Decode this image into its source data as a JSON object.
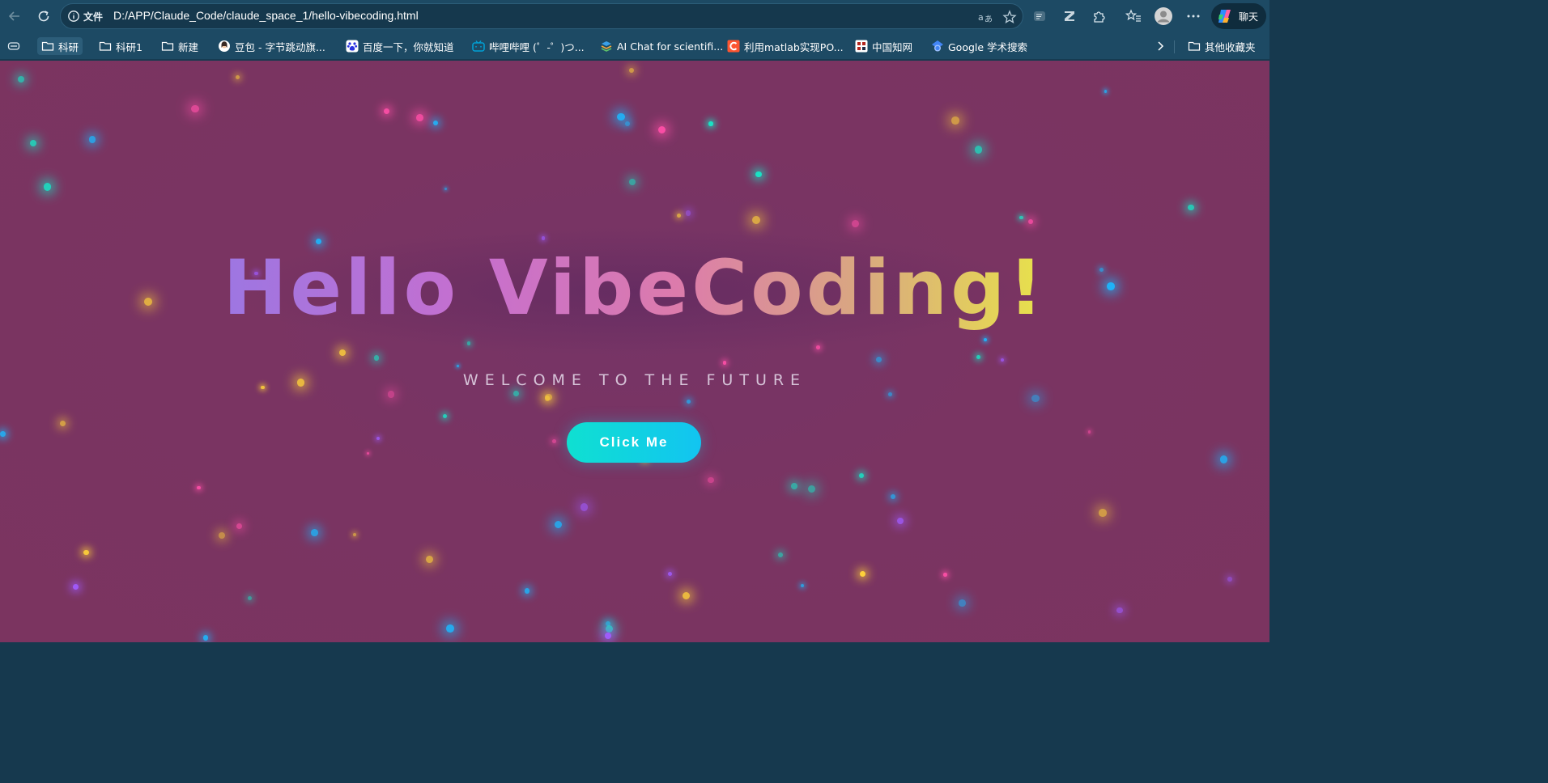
{
  "toolbar": {
    "scheme_label": "文件",
    "url": "D:/APP/Claude_Code/claude_space_1/hello-vibecoding.html",
    "chat_label": "聊天"
  },
  "bookmarks": [
    {
      "label": "科研",
      "icon": "folder-icon"
    },
    {
      "label": "科研1",
      "icon": "folder-icon"
    },
    {
      "label": "新建",
      "icon": "folder-icon"
    },
    {
      "label": "豆包 - 字节跳动旗...",
      "icon": "doubao-icon"
    },
    {
      "label": "百度一下，你就知道",
      "icon": "baidu-icon"
    },
    {
      "label": "哔哩哔哩 (゜-゜)つ...",
      "icon": "bilibili-icon"
    },
    {
      "label": "AI Chat for scientifi...",
      "icon": "layers-icon"
    },
    {
      "label": "利用matlab实现PO...",
      "icon": "csdn-icon"
    },
    {
      "label": "中国知网",
      "icon": "cnki-icon"
    },
    {
      "label": "Google 学术搜索",
      "icon": "google-scholar-icon"
    }
  ],
  "other_bookmarks": "其他收藏夹",
  "page": {
    "title": "Hello VibeCoding!",
    "subtitle": "WELCOME TO THE FUTURE",
    "button_label": "Click Me"
  },
  "colors": {
    "background": "#7a3462",
    "button_start": "#0fe0d1",
    "button_end": "#12c4f1",
    "particles": [
      "#ffd23a",
      "#17e8c8",
      "#1cb8ff",
      "#ff4fa8",
      "#a15cff"
    ]
  }
}
